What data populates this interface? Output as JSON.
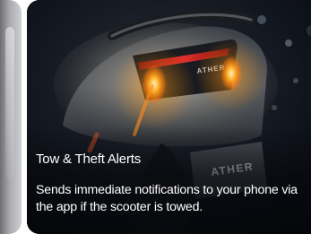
{
  "feature_card": {
    "title": "Tow & Theft Alerts",
    "description": "Sends immediate notifications to your phone via the app if the scooter is towed.",
    "image": {
      "subject": "scooter-rear-tail-light-icon",
      "brand_text_tail": "ATHER",
      "brand_text_plate": "ATHER",
      "accent_color": "#ff9a1a",
      "brake_light_color": "#ff3b2f"
    }
  },
  "previous_card": {
    "image": "partial-card-icon"
  }
}
